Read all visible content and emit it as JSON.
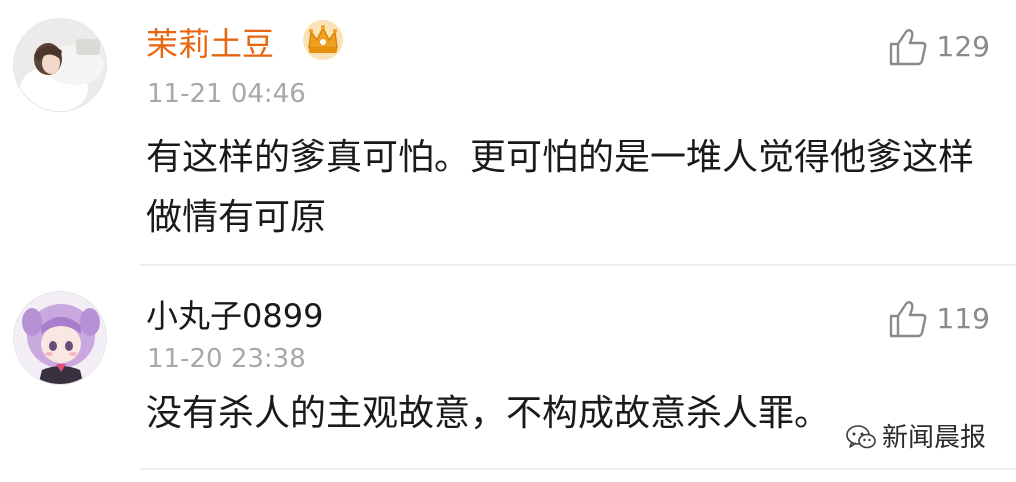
{
  "colors": {
    "vip_username": "#e8660f",
    "username": "#1a1a1a",
    "timestamp": "#a8a8a8",
    "like_icon": "#8a8a8a",
    "crown": "#f0a020"
  },
  "comments": [
    {
      "username": "茉莉土豆",
      "badge_icon": "crown-icon",
      "timestamp": "11-21 04:46",
      "text": "有这样的爹真可怕。更可怕的是一堆人觉得他爹这样做情有可原",
      "likes": "129",
      "like_icon": "thumbs-up-icon"
    },
    {
      "username": "小丸子0899",
      "timestamp": "11-20 23:38",
      "text": "没有杀人的主观故意，不构成故意杀人罪。",
      "likes": "119",
      "like_icon": "thumbs-up-icon"
    }
  ],
  "watermark": {
    "text": "新闻晨报",
    "icon": "wechat-icon"
  }
}
